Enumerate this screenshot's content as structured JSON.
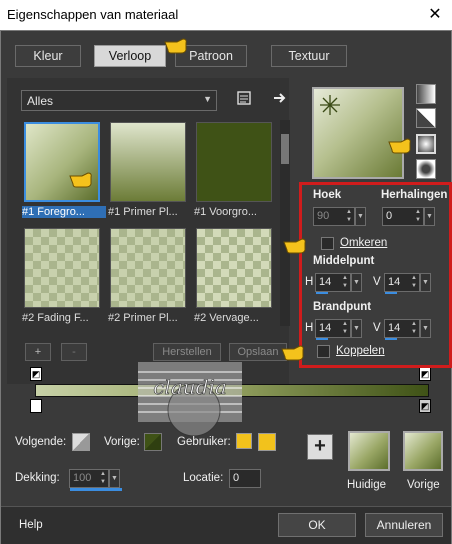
{
  "window": {
    "title": "Eigenschappen van materiaal",
    "close": "✕"
  },
  "tabs": [
    "Kleur",
    "Verloop",
    "Patroon",
    "Textuur"
  ],
  "category": {
    "value": "Alles"
  },
  "swatches": [
    {
      "label": "#1 Foregro..."
    },
    {
      "label": "#1 Primer Pl..."
    },
    {
      "label": "#1 Voorgro..."
    },
    {
      "label": "#2 Fading F..."
    },
    {
      "label": "#2 Primer Pl..."
    },
    {
      "label": "#2 Vervage..."
    }
  ],
  "swatch_colors": {
    "fg_top": "#dfe6c8",
    "fg_bottom": "#5c6e2c",
    "primer_top": "#dfe5cc",
    "primer_bottom": "#6c7c37",
    "solid": "#3f5216",
    "accent": "#3b8de0",
    "red_box": "#d01c1c"
  },
  "actions": {
    "add": "+",
    "remove": "-",
    "reset": "Herstellen",
    "save": "Opslaan"
  },
  "props": {
    "hoek_label": "Hoek",
    "hoek_value": "90",
    "herhalingen_label": "Herhalingen",
    "herhalingen_value": "0",
    "omkeren_label": "Omkeren",
    "middelpunt_label": "Middelpunt",
    "h_label": "H",
    "v_label": "V",
    "mid_h": "14",
    "mid_v": "14",
    "brandpunt_label": "Brandpunt",
    "bp_h": "14",
    "bp_v": "14",
    "koppelen_label": "Koppelen"
  },
  "watermark": {
    "text": "claudia"
  },
  "bottom": {
    "volgende_label": "Volgende:",
    "vorige_label": "Vorige:",
    "gebruiker_label": "Gebruiker:",
    "dekking_label": "Dekking:",
    "dekking_value": "100",
    "locatie_label": "Locatie:",
    "locatie_value": "0",
    "plus": "+",
    "huidige_label": "Huidige",
    "vorige_swatch_label": "Vorige"
  },
  "footer": {
    "help": "Help",
    "ok": "OK",
    "cancel": "Annuleren"
  }
}
